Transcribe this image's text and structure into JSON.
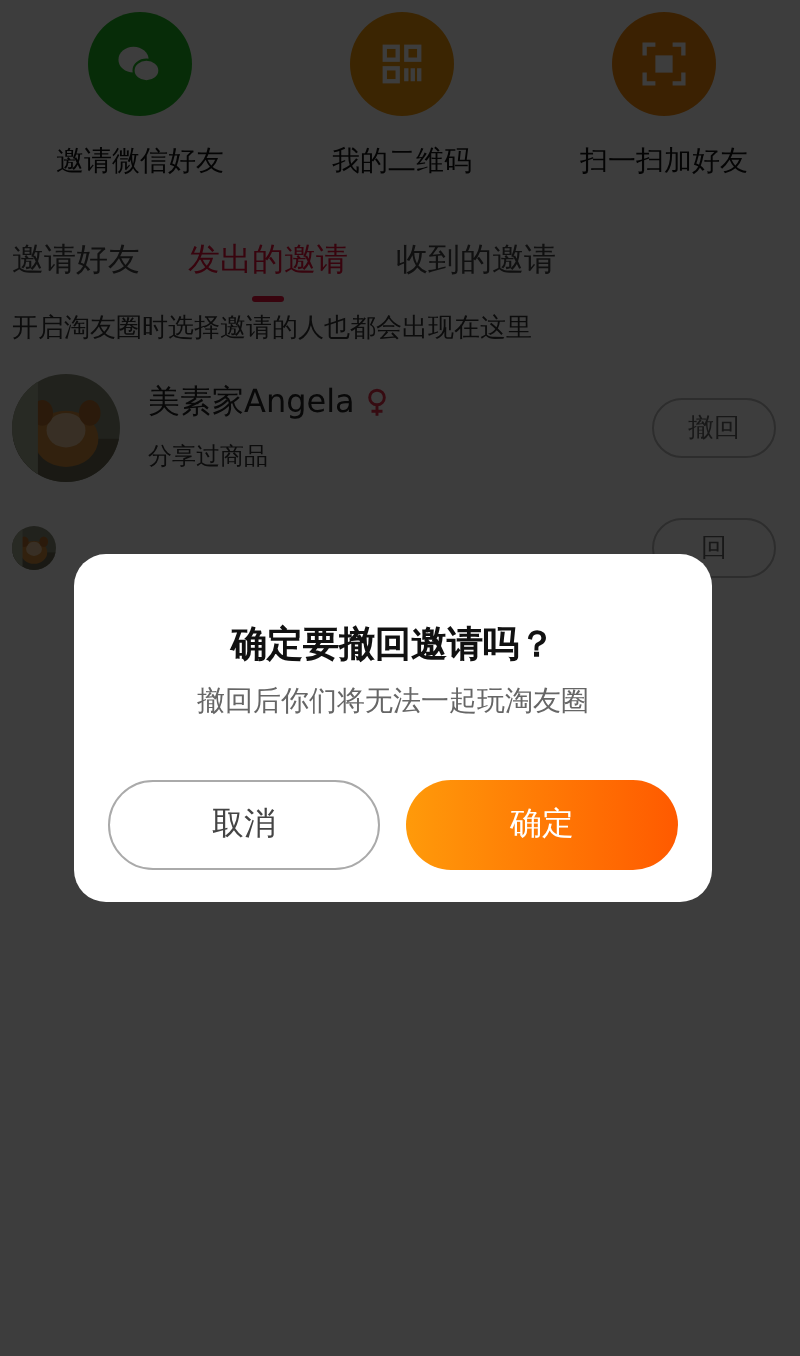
{
  "shortcuts": [
    {
      "kind": "wechat",
      "label": "邀请微信好友"
    },
    {
      "kind": "qrcode",
      "label": "我的二维码"
    },
    {
      "kind": "scan",
      "label": "扫一扫加好友"
    }
  ],
  "tabs": [
    {
      "label": "邀请好友",
      "selected": false
    },
    {
      "label": "发出的邀请",
      "selected": true
    },
    {
      "label": "收到的邀请",
      "selected": false
    }
  ],
  "hint": "开启淘友圈时选择邀请的人也都会出现在这里",
  "invitations": [
    {
      "name": "美素家Angela",
      "subtitle": "分享过商品",
      "action": "撤回"
    },
    {
      "action": "回"
    }
  ],
  "dialog": {
    "title": "确定要撤回邀请吗？",
    "message": "撤回后你们将无法一起玩淘友圈",
    "buttons": [
      {
        "kind": "cancel",
        "label": "取消"
      },
      {
        "kind": "confirm",
        "label": "确定"
      }
    ]
  }
}
